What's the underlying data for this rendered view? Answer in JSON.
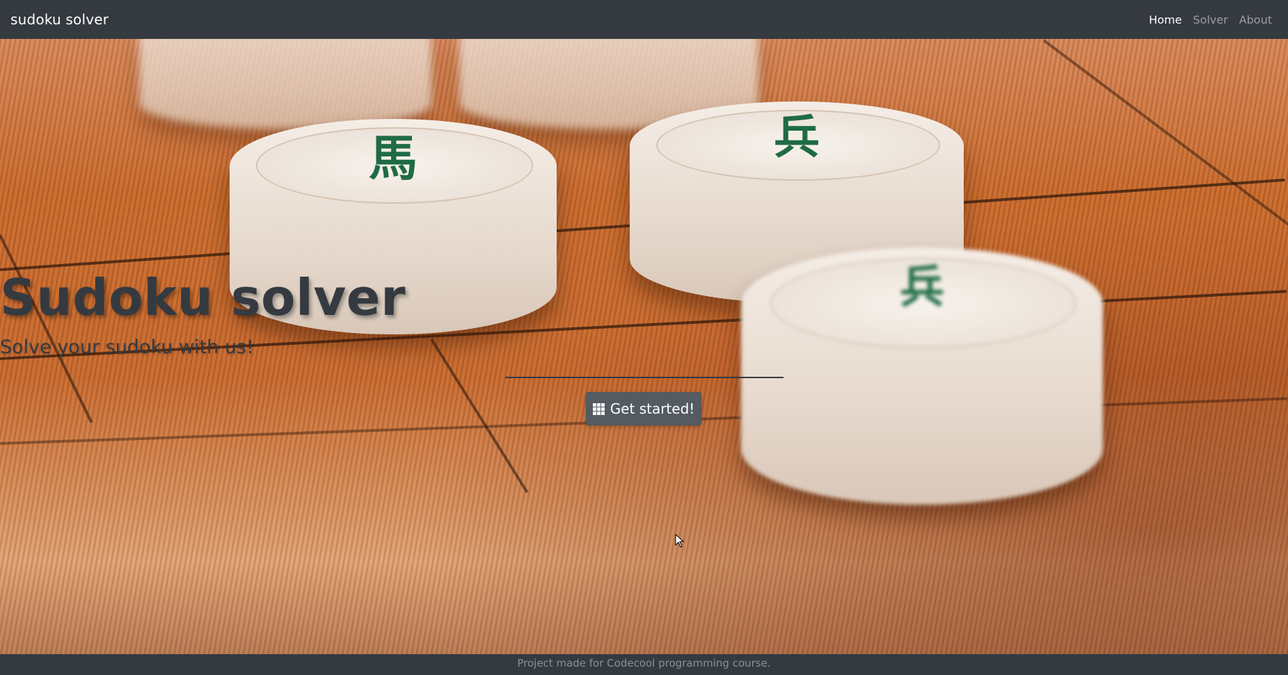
{
  "navbar": {
    "brand": "sudoku solver",
    "links": [
      {
        "label": "Home",
        "active": true
      },
      {
        "label": "Solver",
        "active": false
      },
      {
        "label": "About",
        "active": false
      }
    ]
  },
  "hero": {
    "title": "Sudoku solver",
    "subtitle": "Solve your sudoku with us!",
    "cta_label": "Get started!",
    "cta_icon": "grid-icon",
    "background": "photo of xiangqi pieces on a wooden board"
  },
  "footer": {
    "text": "Project made for Codecool programming course."
  },
  "colors": {
    "navbar_bg": "#343a40",
    "title_color": "#343a40",
    "button_bg": "#545b62",
    "footer_text": "#8a9096"
  }
}
